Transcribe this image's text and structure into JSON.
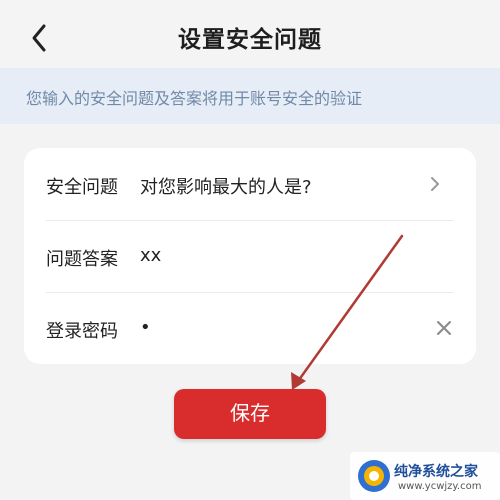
{
  "header": {
    "title": "设置安全问题",
    "back_icon": "back-arrow-icon"
  },
  "notice": {
    "text": "您输入的安全问题及答案将用于账号安全的验证"
  },
  "form": {
    "rows": [
      {
        "label": "安全问题",
        "value": "对您影响最大的人是?",
        "icon": "chevron-right-icon"
      },
      {
        "label": "问题答案",
        "value": "xx"
      },
      {
        "label": "登录密码",
        "value": "•",
        "icon": "clear-icon"
      }
    ]
  },
  "actions": {
    "save_label": "保存",
    "save_color": "#d92d2d"
  },
  "watermark": {
    "name": "纯净系统之家",
    "url": "www.ycwjzy.com"
  },
  "colors": {
    "background": "#f3f3f3",
    "notice_bg": "#e6edf6",
    "notice_text": "#7189a8",
    "annotation_arrow": "#b03a34"
  }
}
